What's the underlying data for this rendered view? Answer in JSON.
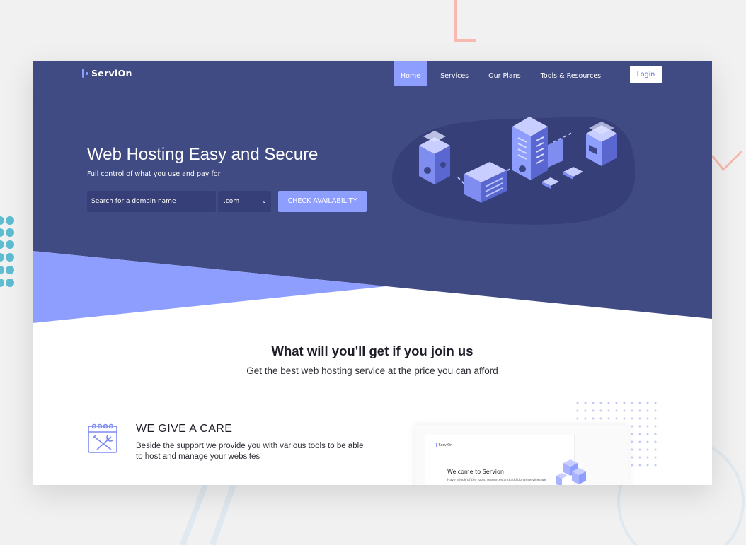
{
  "nav": {
    "logo": "ServiOn",
    "items": [
      {
        "label": "Home",
        "active": true
      },
      {
        "label": "Services",
        "active": false
      },
      {
        "label": "Our Plans",
        "active": false
      },
      {
        "label": "Tools & Resources",
        "active": false
      }
    ],
    "login": "Login"
  },
  "hero": {
    "title": "Web Hosting Easy and Secure",
    "subtitle": "Full control of what you use and pay for",
    "search_placeholder": "Search for a domain name",
    "tld_selected": ".com",
    "cta": "CHECK AVAILABILITY",
    "illustration": "isometric-servers-illustration"
  },
  "features": {
    "title": "What will you'll get if you join us",
    "subtitle": "Get the best web hosting service at the price you can afford",
    "items": [
      {
        "icon": "tools-calendar-icon",
        "title": "WE GIVE A CARE",
        "description": "Beside the support we provide you with various tools to be able to host and manage your websites"
      }
    ]
  },
  "preview": {
    "logo": "ServiOn",
    "title": "Welcome to Servion",
    "line": "Have a look of the tools, resources and additional services we"
  },
  "colors": {
    "hero_bg": "#414b83",
    "accent": "#8e9eff",
    "page_bg": "#f1f1f1",
    "blob": "#373f78"
  }
}
